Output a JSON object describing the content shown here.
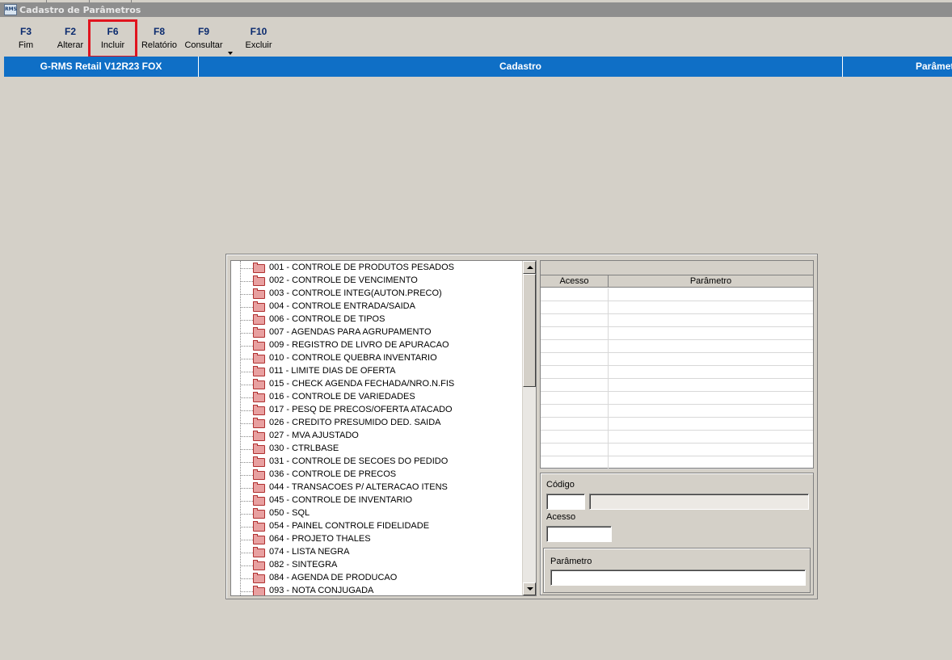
{
  "window": {
    "title": "Cadastro de Parâmetros",
    "icon": "rms-app-icon",
    "icon_text": "RMS"
  },
  "toolbar": {
    "buttons": [
      {
        "key": "F3",
        "label": "Fim"
      },
      {
        "key": "F2",
        "label": "Alterar"
      },
      {
        "key": "F6",
        "label": "Incluir"
      },
      {
        "key": "F8",
        "label": "Relatório"
      },
      {
        "key": "F9",
        "label": "Consultar"
      },
      {
        "key": "F10",
        "label": "Excluir"
      }
    ],
    "highlighted": "F6",
    "highlight_color": "#e0141e"
  },
  "header": {
    "system": "G-RMS Retail V12R23 FOX",
    "module": "Cadastro",
    "section": "Parâmetros",
    "color": "#0f6fc6"
  },
  "tree": {
    "items": [
      "001 - CONTROLE DE PRODUTOS PESADOS",
      "002 - CONTROLE DE VENCIMENTO",
      "003 - CONTROLE INTEG(AUTON.PRECO)",
      "004 - CONTROLE ENTRADA/SAIDA",
      "006 - CONTROLE DE TIPOS",
      "007 - AGENDAS PARA AGRUPAMENTO",
      "009 - REGISTRO DE LIVRO DE APURACAO",
      "010 - CONTROLE QUEBRA INVENTARIO",
      "011 - LIMITE DIAS DE OFERTA",
      "015 - CHECK AGENDA FECHADA/NRO.N.FIS",
      "016 - CONTROLE DE VARIEDADES",
      "017 - PESQ DE PRECOS/OFERTA ATACADO",
      "026 - CREDITO PRESUMIDO DED. SAIDA",
      "027 - MVA AJUSTADO",
      "030 - CTRLBASE",
      "031 - CONTROLE DE SECOES DO PEDIDO",
      "036 - CONTROLE DE PRECOS",
      "044 - TRANSACOES P/ ALTERACAO ITENS",
      "045 - CONTROLE DE INVENTARIO",
      "050 - SQL",
      "054 - PAINEL CONTROLE FIDELIDADE",
      "064 - PROJETO THALES",
      "074 - LISTA NEGRA",
      "082 - SINTEGRA",
      "084 - AGENDA DE PRODUCAO",
      "093 - NOTA CONJUGADA"
    ],
    "folder_color": "#e8a0a0"
  },
  "grid": {
    "columns": [
      "Acesso",
      "Parâmetro"
    ]
  },
  "form": {
    "codigo_label": "Código",
    "codigo_value": "",
    "codigo_desc": "",
    "acesso_label": "Acesso",
    "acesso_value": "",
    "parametro_label": "Parâmetro",
    "parametro_value": ""
  }
}
